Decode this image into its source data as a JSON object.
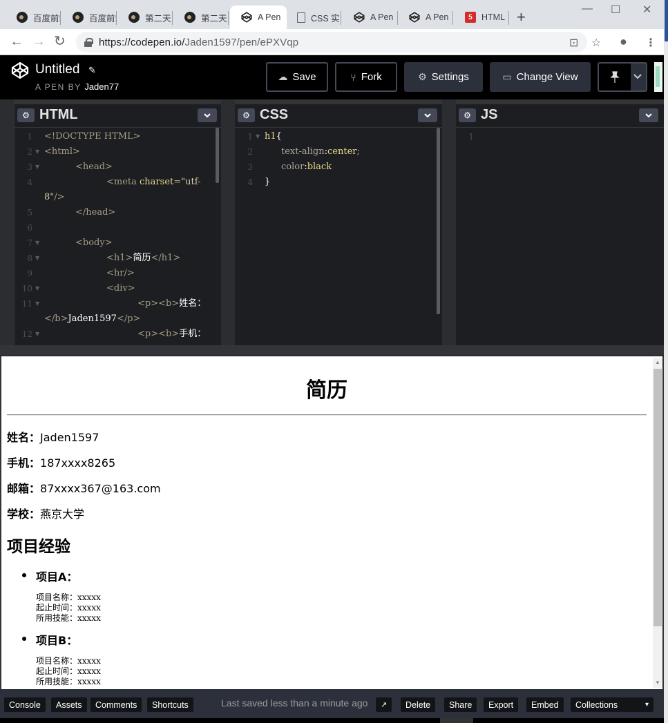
{
  "browser": {
    "tabs": [
      {
        "label": "百度前端",
        "icon": "dark-favicon",
        "active": false
      },
      {
        "label": "百度前端",
        "icon": "dark-favicon",
        "active": false
      },
      {
        "label": "第二天",
        "icon": "dark-favicon",
        "active": false
      },
      {
        "label": "第二天",
        "icon": "dark-favicon",
        "active": false
      },
      {
        "label": "A Pen",
        "icon": "codepen-icon",
        "active": true
      },
      {
        "label": "CSS 实",
        "icon": "document-icon",
        "active": false
      },
      {
        "label": "A Pen",
        "icon": "codepen-icon",
        "active": false
      },
      {
        "label": "A Pen",
        "icon": "codepen-icon",
        "active": false
      },
      {
        "label": "HTML",
        "icon": "html5-icon",
        "active": false
      }
    ],
    "new_tab": "+",
    "window_controls": {
      "minimize": "—",
      "maximize": "☐",
      "close": "✕"
    },
    "url_host": "https://codepen.io/",
    "url_path": "Jaden1597/pen/ePXVqp",
    "nav": {
      "back": "←",
      "forward": "→",
      "reload": "↻"
    },
    "toolbar_icons": {
      "translate": "⊡",
      "bookmark": "☆",
      "profile": "●",
      "menu": "⋮"
    }
  },
  "pen": {
    "title": "Untitled",
    "edit_icon": "✎",
    "by_label": "A PEN BY",
    "author": "Jaden77",
    "buttons": {
      "save": "Save",
      "fork": "Fork",
      "settings": "Settings",
      "change_view": "Change View"
    },
    "icons": {
      "cloud": "☁",
      "fork": "⑂",
      "gear": "⚙",
      "view": "▭",
      "pin": "📌",
      "chevron": "⌄"
    }
  },
  "editors": {
    "html": {
      "title": "HTML",
      "lines": [
        {
          "n": "1",
          "fold": false,
          "indent": 0,
          "parts": [
            [
              "tag",
              "<!DOCTYPE HTML>"
            ]
          ]
        },
        {
          "n": "2",
          "fold": true,
          "indent": 0,
          "parts": [
            [
              "tag",
              "<html>"
            ]
          ]
        },
        {
          "n": "3",
          "fold": true,
          "indent": 1,
          "parts": [
            [
              "tag",
              "<head>"
            ]
          ]
        },
        {
          "n": "4",
          "fold": false,
          "indent": 2,
          "parts": [
            [
              "tag",
              "<meta "
            ],
            [
              "attr",
              "charset"
            ],
            [
              "tag",
              "="
            ],
            [
              "str",
              "\"utf-"
            ]
          ]
        },
        {
          "n": "",
          "fold": false,
          "indent": 0,
          "parts": [
            [
              "str",
              "8\""
            ],
            [
              "tag",
              "/>"
            ]
          ]
        },
        {
          "n": "5",
          "fold": false,
          "indent": 1,
          "parts": [
            [
              "tag",
              "</head>"
            ]
          ]
        },
        {
          "n": "6",
          "fold": false,
          "indent": 0,
          "parts": []
        },
        {
          "n": "7",
          "fold": true,
          "indent": 1,
          "parts": [
            [
              "tag",
              "<body>"
            ]
          ]
        },
        {
          "n": "8",
          "fold": true,
          "indent": 2,
          "parts": [
            [
              "tag",
              "<h1>"
            ],
            [
              "txt",
              "简历"
            ],
            [
              "tag",
              "</h1>"
            ]
          ]
        },
        {
          "n": "9",
          "fold": false,
          "indent": 2,
          "parts": [
            [
              "tag",
              "<hr/>"
            ]
          ]
        },
        {
          "n": "10",
          "fold": true,
          "indent": 2,
          "parts": [
            [
              "tag",
              "<div>"
            ]
          ]
        },
        {
          "n": "11",
          "fold": true,
          "indent": 3,
          "parts": [
            [
              "tag",
              "<p><b>"
            ],
            [
              "txt",
              "姓名："
            ]
          ]
        },
        {
          "n": "",
          "fold": false,
          "indent": 0,
          "parts": [
            [
              "tag",
              "</b>"
            ],
            [
              "txt",
              "Jaden1597"
            ],
            [
              "tag",
              "</p>"
            ]
          ]
        },
        {
          "n": "12",
          "fold": true,
          "indent": 3,
          "parts": [
            [
              "tag",
              "<p><b>"
            ],
            [
              "txt",
              "手机："
            ]
          ]
        }
      ]
    },
    "css": {
      "title": "CSS",
      "lines": [
        {
          "n": "1",
          "fold": true,
          "indent": 0,
          "parts": [
            [
              "sel",
              "h1"
            ],
            [
              "txt",
              "{"
            ]
          ]
        },
        {
          "n": "2",
          "fold": false,
          "indent": 1,
          "parts": [
            [
              "prop",
              "text-align"
            ],
            [
              "txt",
              ":"
            ],
            [
              "val",
              "center"
            ],
            [
              "prop",
              ";"
            ]
          ]
        },
        {
          "n": "3",
          "fold": false,
          "indent": 1,
          "parts": [
            [
              "prop",
              "color"
            ],
            [
              "txt",
              ":"
            ],
            [
              "val",
              "black"
            ]
          ]
        },
        {
          "n": "4",
          "fold": false,
          "indent": 0,
          "parts": [
            [
              "txt",
              "}"
            ]
          ]
        }
      ]
    },
    "js": {
      "title": "JS",
      "lines": [
        {
          "n": "1",
          "fold": false,
          "indent": 0,
          "parts": []
        }
      ]
    }
  },
  "preview": {
    "heading": "简历",
    "info": [
      {
        "label": "姓名：",
        "value": "Jaden1597"
      },
      {
        "label": "手机：",
        "value": "187xxxx8265"
      },
      {
        "label": "邮箱：",
        "value": "87xxxx367@163.com"
      },
      {
        "label": "学校：",
        "value": "燕京大学"
      }
    ],
    "section_title": "项目经验",
    "projects": [
      {
        "title": "项目A：",
        "details": [
          [
            "项目名称：",
            "xxxxx"
          ],
          [
            "起止时间：",
            "xxxxx"
          ],
          [
            "所用技能：",
            "xxxxx"
          ]
        ]
      },
      {
        "title": "项目B：",
        "details": [
          [
            "项目名称：",
            "xxxxx"
          ],
          [
            "起止时间：",
            "xxxxx"
          ],
          [
            "所用技能：",
            "xxxxx"
          ]
        ]
      }
    ]
  },
  "footer": {
    "left_buttons": [
      "Console",
      "Assets",
      "Comments",
      "Shortcuts"
    ],
    "status": "Last saved less than a minute ago",
    "external_icon": "↗",
    "right_buttons": [
      "Delete",
      "Share",
      "Export",
      "Embed"
    ],
    "collections": "Collections",
    "collections_caret": "▾"
  }
}
